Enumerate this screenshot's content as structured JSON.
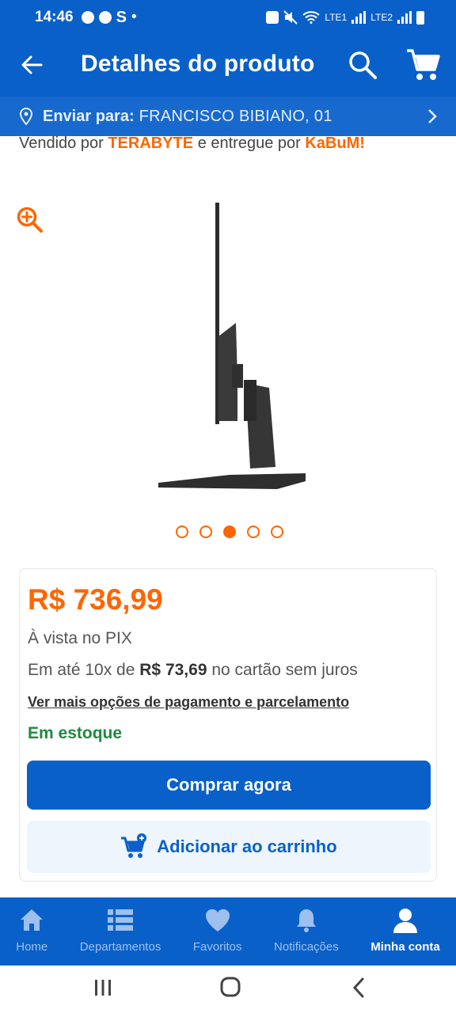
{
  "status_bar": {
    "time": "14:46",
    "net1": "LTE1",
    "net2": "LTE2"
  },
  "app_bar": {
    "title": "Detalhes do produto",
    "icons": [
      "arrow-back-icon",
      "search-icon",
      "cart-icon"
    ]
  },
  "shipping": {
    "label": "Enviar para:",
    "address": "FRANCISCO BIBIANO, 01"
  },
  "seller": {
    "prefix": "Vendido por",
    "seller_name": "TERABYTE",
    "middle": "e entregue por",
    "shipper_name": "KaBuM!"
  },
  "gallery": {
    "image_count": 5,
    "active_index": 2
  },
  "pricing": {
    "price": "R$ 736,99",
    "pix_note": "À vista no PIX",
    "installments_prefix": "Em até 10x de",
    "installment_value": "R$ 73,69",
    "installments_suffix": "no cartão sem juros",
    "more_options": "Ver mais opções de pagamento e parcelamento",
    "stock": "Em estoque",
    "buy_label": "Comprar agora",
    "add_to_cart_label": "Adicionar ao carrinho"
  },
  "bottom_nav": {
    "items": [
      {
        "label": "Home",
        "icon": "home-icon"
      },
      {
        "label": "Departamentos",
        "icon": "list-icon"
      },
      {
        "label": "Favoritos",
        "icon": "heart-icon"
      },
      {
        "label": "Notificações",
        "icon": "bell-icon"
      },
      {
        "label": "Minha conta",
        "icon": "user-icon"
      }
    ],
    "active": "Minha conta"
  },
  "colors": {
    "primary": "#0a60c9",
    "accent": "#ff6500",
    "stock": "#1e8a3e"
  }
}
